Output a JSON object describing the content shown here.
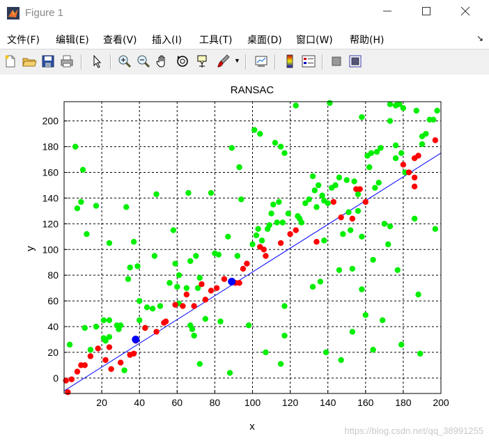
{
  "window": {
    "title": "Figure 1",
    "minimize_icon": "minimize-icon",
    "maximize_icon": "maximize-icon",
    "close_icon": "close-icon"
  },
  "menu": {
    "items": [
      {
        "label": "文件(F)"
      },
      {
        "label": "编辑(E)"
      },
      {
        "label": "查看(V)"
      },
      {
        "label": "插入(I)"
      },
      {
        "label": "工具(T)"
      },
      {
        "label": "桌面(D)"
      },
      {
        "label": "窗口(W)"
      },
      {
        "label": "帮助(H)"
      }
    ]
  },
  "toolbar": {
    "icons": [
      "new-file-icon",
      "open-folder-icon",
      "save-icon",
      "print-icon",
      "pointer-icon",
      "zoom-in-icon",
      "zoom-out-icon",
      "pan-hand-icon",
      "rotate-3d-icon",
      "data-cursor-icon",
      "brush-icon",
      "link-plot-icon",
      "colorbar-icon",
      "legend-icon",
      "hide-plot-tools-icon",
      "show-plot-tools-icon"
    ]
  },
  "watermark": "https://blog.csdn.net/qq_38991255",
  "colors": {
    "inlier": "#ff0000",
    "outlier": "#00ee00",
    "sample": "#0000ff",
    "fit_line": "#0000ff"
  },
  "chart_data": {
    "type": "scatter",
    "title": "RANSAC",
    "xlabel": "x",
    "ylabel": "y",
    "xlim": [
      0,
      200
    ],
    "ylim": [
      -12,
      215
    ],
    "xticks": [
      20,
      40,
      60,
      80,
      100,
      120,
      140,
      160,
      180,
      200
    ],
    "yticks": [
      0,
      20,
      40,
      60,
      80,
      100,
      120,
      140,
      160,
      180,
      200
    ],
    "grid": true,
    "series": [
      {
        "role": "inliers",
        "color": "#ff0000",
        "points": [
          [
            1,
            -2
          ],
          [
            2,
            -11
          ],
          [
            4,
            -1
          ],
          [
            7,
            5
          ],
          [
            9,
            10
          ],
          [
            11,
            10
          ],
          [
            14,
            17
          ],
          [
            18,
            23
          ],
          [
            22,
            14
          ],
          [
            24,
            24
          ],
          [
            25,
            7
          ],
          [
            30,
            12
          ],
          [
            35,
            18
          ],
          [
            37,
            19
          ],
          [
            38,
            29
          ],
          [
            43,
            39
          ],
          [
            49,
            36
          ],
          [
            53,
            43
          ],
          [
            54,
            44
          ],
          [
            59,
            57
          ],
          [
            63,
            56
          ],
          [
            65,
            65
          ],
          [
            69,
            56
          ],
          [
            73,
            73
          ],
          [
            75,
            61
          ],
          [
            78,
            68
          ],
          [
            81,
            70
          ],
          [
            85,
            77
          ],
          [
            91,
            74
          ],
          [
            93,
            74
          ],
          [
            95,
            85
          ],
          [
            97,
            89
          ],
          [
            104,
            102
          ],
          [
            106,
            100
          ],
          [
            107,
            95
          ],
          [
            115,
            105
          ],
          [
            120,
            112
          ],
          [
            123,
            115
          ],
          [
            134,
            106
          ],
          [
            143,
            137
          ],
          [
            147,
            125
          ],
          [
            153,
            124
          ],
          [
            155,
            147
          ],
          [
            157,
            147
          ],
          [
            160,
            137
          ],
          [
            180,
            166
          ],
          [
            183,
            160
          ],
          [
            186,
            171
          ],
          [
            186,
            156
          ],
          [
            186,
            149
          ],
          [
            188,
            173
          ],
          [
            197,
            185
          ]
        ]
      },
      {
        "role": "outliers",
        "color": "#00ee00",
        "points": [
          [
            3,
            26
          ],
          [
            6,
            180
          ],
          [
            7,
            132
          ],
          [
            9,
            137
          ],
          [
            10,
            162
          ],
          [
            11,
            39
          ],
          [
            12,
            112
          ],
          [
            14,
            22
          ],
          [
            17,
            134
          ],
          [
            17,
            40
          ],
          [
            21,
            45
          ],
          [
            21,
            31
          ],
          [
            22,
            29
          ],
          [
            24,
            45
          ],
          [
            24,
            105
          ],
          [
            24,
            32
          ],
          [
            28,
            41
          ],
          [
            29,
            38
          ],
          [
            30,
            41
          ],
          [
            32,
            6
          ],
          [
            33,
            133
          ],
          [
            34,
            77
          ],
          [
            35,
            86
          ],
          [
            37,
            106
          ],
          [
            39,
            87
          ],
          [
            40,
            45
          ],
          [
            40,
            60
          ],
          [
            43,
            39
          ],
          [
            44,
            55
          ],
          [
            47,
            54
          ],
          [
            48,
            95
          ],
          [
            49,
            143
          ],
          [
            51,
            56
          ],
          [
            56,
            74
          ],
          [
            58,
            115
          ],
          [
            59,
            89
          ],
          [
            60,
            71
          ],
          [
            61,
            80
          ],
          [
            61,
            58
          ],
          [
            65,
            70
          ],
          [
            66,
            144
          ],
          [
            67,
            91
          ],
          [
            67,
            41
          ],
          [
            68,
            38
          ],
          [
            69,
            33
          ],
          [
            70,
            95
          ],
          [
            71,
            70
          ],
          [
            72,
            78
          ],
          [
            72,
            11
          ],
          [
            75,
            46
          ],
          [
            78,
            144
          ],
          [
            80,
            97
          ],
          [
            82,
            96
          ],
          [
            83,
            44
          ],
          [
            87,
            110
          ],
          [
            88,
            4
          ],
          [
            89,
            179
          ],
          [
            92,
            95
          ],
          [
            93,
            164
          ],
          [
            94,
            139
          ],
          [
            98,
            41
          ],
          [
            100,
            104
          ],
          [
            101,
            193
          ],
          [
            102,
            111
          ],
          [
            103,
            116
          ],
          [
            104,
            190
          ],
          [
            105,
            107
          ],
          [
            107,
            20
          ],
          [
            108,
            116
          ],
          [
            109,
            119
          ],
          [
            110,
            128
          ],
          [
            111,
            135
          ],
          [
            112,
            183
          ],
          [
            113,
            121
          ],
          [
            114,
            137
          ],
          [
            115,
            11
          ],
          [
            115,
            180
          ],
          [
            116,
            121
          ],
          [
            117,
            175
          ],
          [
            117,
            56
          ],
          [
            117,
            33
          ],
          [
            119,
            128
          ],
          [
            123,
            212
          ],
          [
            124,
            126
          ],
          [
            125,
            124
          ],
          [
            126,
            121
          ],
          [
            128,
            136
          ],
          [
            130,
            139
          ],
          [
            132,
            157
          ],
          [
            132,
            71
          ],
          [
            133,
            146
          ],
          [
            134,
            133
          ],
          [
            135,
            150
          ],
          [
            136,
            75
          ],
          [
            137,
            142
          ],
          [
            138,
            138
          ],
          [
            138,
            107
          ],
          [
            139,
            20
          ],
          [
            140,
            136
          ],
          [
            141,
            214
          ],
          [
            142,
            148
          ],
          [
            144,
            150
          ],
          [
            146,
            156
          ],
          [
            146,
            84
          ],
          [
            147,
            14
          ],
          [
            148,
            112
          ],
          [
            150,
            154
          ],
          [
            151,
            129
          ],
          [
            152,
            115
          ],
          [
            153,
            85
          ],
          [
            153,
            36
          ],
          [
            154,
            153
          ],
          [
            156,
            143
          ],
          [
            156,
            130
          ],
          [
            158,
            203
          ],
          [
            158,
            69
          ],
          [
            158,
            110
          ],
          [
            160,
            49
          ],
          [
            161,
            173
          ],
          [
            162,
            164
          ],
          [
            163,
            175
          ],
          [
            164,
            22
          ],
          [
            164,
            92
          ],
          [
            165,
            148
          ],
          [
            166,
            176
          ],
          [
            167,
            152
          ],
          [
            168,
            179
          ],
          [
            169,
            45
          ],
          [
            170,
            120
          ],
          [
            172,
            104
          ],
          [
            173,
            118
          ],
          [
            173,
            200
          ],
          [
            173,
            213
          ],
          [
            176,
            171
          ],
          [
            176,
            181
          ],
          [
            176,
            212
          ],
          [
            177,
            213
          ],
          [
            177,
            84
          ],
          [
            178,
            213
          ],
          [
            179,
            26
          ],
          [
            179,
            175
          ],
          [
            180,
            210
          ],
          [
            181,
            160
          ],
          [
            186,
            124
          ],
          [
            187,
            208
          ],
          [
            188,
            65
          ],
          [
            189,
            19
          ],
          [
            190,
            182
          ],
          [
            190,
            188
          ],
          [
            192,
            190
          ],
          [
            194,
            201
          ],
          [
            196,
            201
          ],
          [
            197,
            116
          ],
          [
            198,
            208
          ]
        ]
      },
      {
        "role": "sample",
        "color": "#0000ff",
        "points": [
          [
            38,
            30
          ],
          [
            89,
            75
          ]
        ]
      }
    ],
    "fit_line": {
      "color": "#0000ff",
      "x": [
        0,
        200
      ],
      "y": [
        -10,
        175
      ]
    }
  }
}
